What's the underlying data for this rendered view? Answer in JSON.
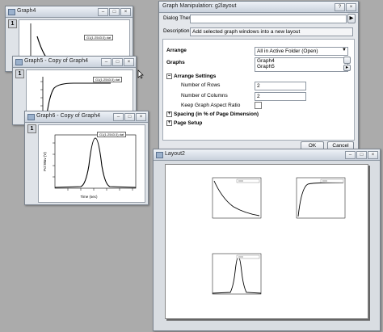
{
  "windows": {
    "graph4": {
      "title": "Graph4",
      "layer": "1",
      "legend": "G1(1:2543:3) dat"
    },
    "graph5": {
      "title": "Graph5 - Copy of Graph4",
      "layer": "1",
      "legend": "G1(1:2543:3) dat"
    },
    "graph6": {
      "title": "Graph6 - Copy of Graph4",
      "layer": "1",
      "legend": "G1(1:2543:3) dat",
      "xlabel": "Time (sec)",
      "ylabel": "Pol Wav (V)"
    },
    "layout2": {
      "title": "Layout2"
    }
  },
  "dialog": {
    "title": "Graph Manipulation: g2layout",
    "theme_label": "Dialog Theme",
    "theme_value": "",
    "theme_arrow": "▶",
    "description_label": "Description",
    "description_value": "Add selected graph windows into a new layout",
    "arrange_label": "Arrange",
    "arrange_value": "All in Active Folder (Open)",
    "graphs_label": "Graphs",
    "graphs": [
      "Graph4",
      "Graph5"
    ],
    "arrange_settings_label": "Arrange Settings",
    "rows_label": "Number of Rows",
    "rows_value": "2",
    "cols_label": "Number of Columns",
    "cols_value": "2",
    "keep_aspect_label": "Keep Graph Aspect Ratio",
    "spacing_label": "Spacing (in % of Page Dimension)",
    "page_setup_label": "Page Setup",
    "ok_label": "OK",
    "cancel_label": "Cancel"
  },
  "colors": {
    "desktop": "#ababab",
    "titlebar": "#c9d1dc",
    "page": "#ffffff"
  }
}
